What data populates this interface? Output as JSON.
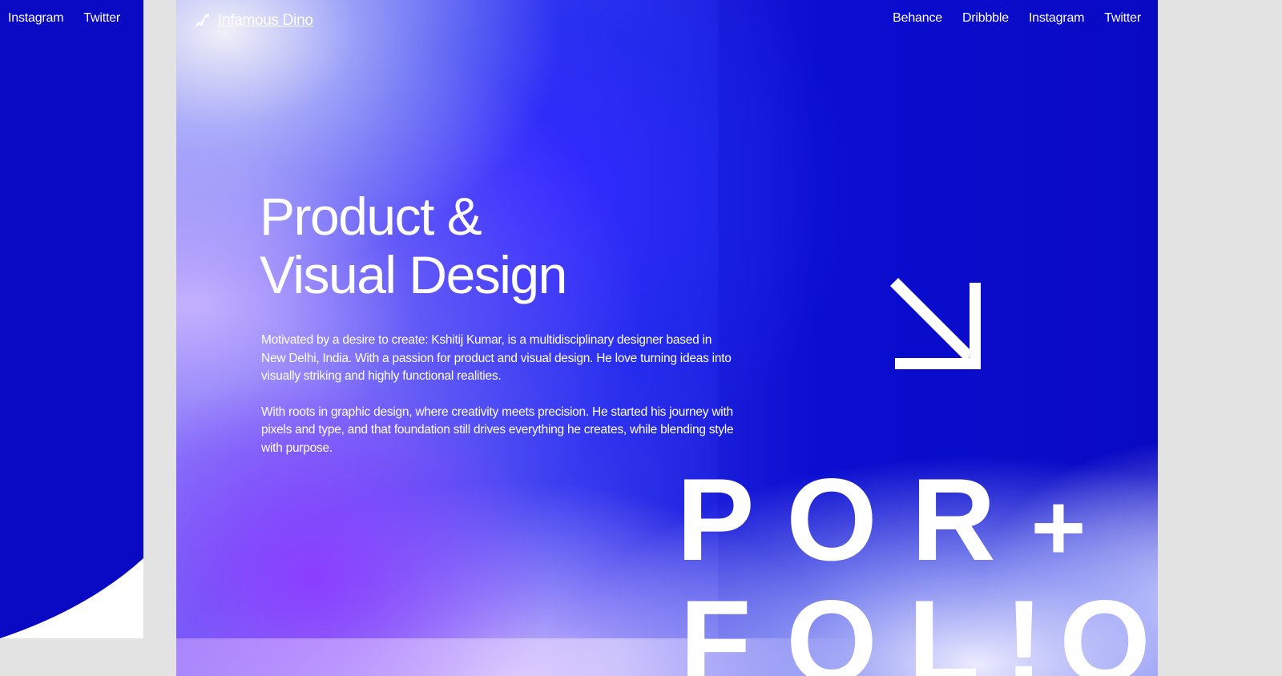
{
  "left_card": {
    "nav": [
      {
        "label": "Instagram"
      },
      {
        "label": "Twitter"
      }
    ]
  },
  "header": {
    "logo_text": "Infamous Dino",
    "nav": [
      {
        "label": "Behance"
      },
      {
        "label": "Dribbble"
      },
      {
        "label": "Instagram"
      },
      {
        "label": "Twitter"
      }
    ]
  },
  "hero": {
    "title_line1": "Product &",
    "title_line2": "Visual Design",
    "paragraphs": [
      "Motivated by a desire to create: Kshitij Kumar, is a multidisciplinary designer based in New Delhi, India. With a passion for product and visual design. He love turning ideas into visually striking and highly functional realities.",
      "With roots in graphic design, where creativity meets precision. He started his journey with pixels and type, and that foundation still drives everything he creates, while blending style with purpose."
    ],
    "arrow_icon": "arrow-down-right-icon"
  },
  "portfolio_word": {
    "row1": [
      "P",
      "O",
      "R",
      "+"
    ],
    "row2": [
      "F",
      "O",
      "L",
      "!",
      "O"
    ]
  },
  "colors": {
    "brand_blue": "#0a0ac4",
    "text": "#ffffff",
    "page_bg": "#e3e3e3"
  }
}
